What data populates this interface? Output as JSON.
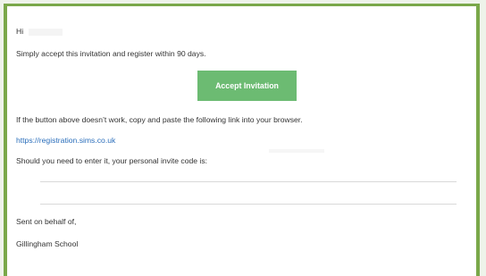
{
  "email": {
    "greeting": "Hi",
    "intro": "Simply accept this invitation and register within 90 days.",
    "accept_button": "Accept Invitation",
    "fallback_text": "If the button above doesn’t work, copy and paste the following link into your browser.",
    "registration_link": "https://registration.sims.co.uk",
    "invite_code_text": "Should you need to enter it, your personal invite code is:",
    "signoff": "Sent on behalf of,",
    "school": "Gillingham School"
  },
  "colors": {
    "frame_border": "#7aa84a",
    "button_bg": "#6cbb72",
    "link": "#2a6ebb",
    "text": "#333333"
  }
}
